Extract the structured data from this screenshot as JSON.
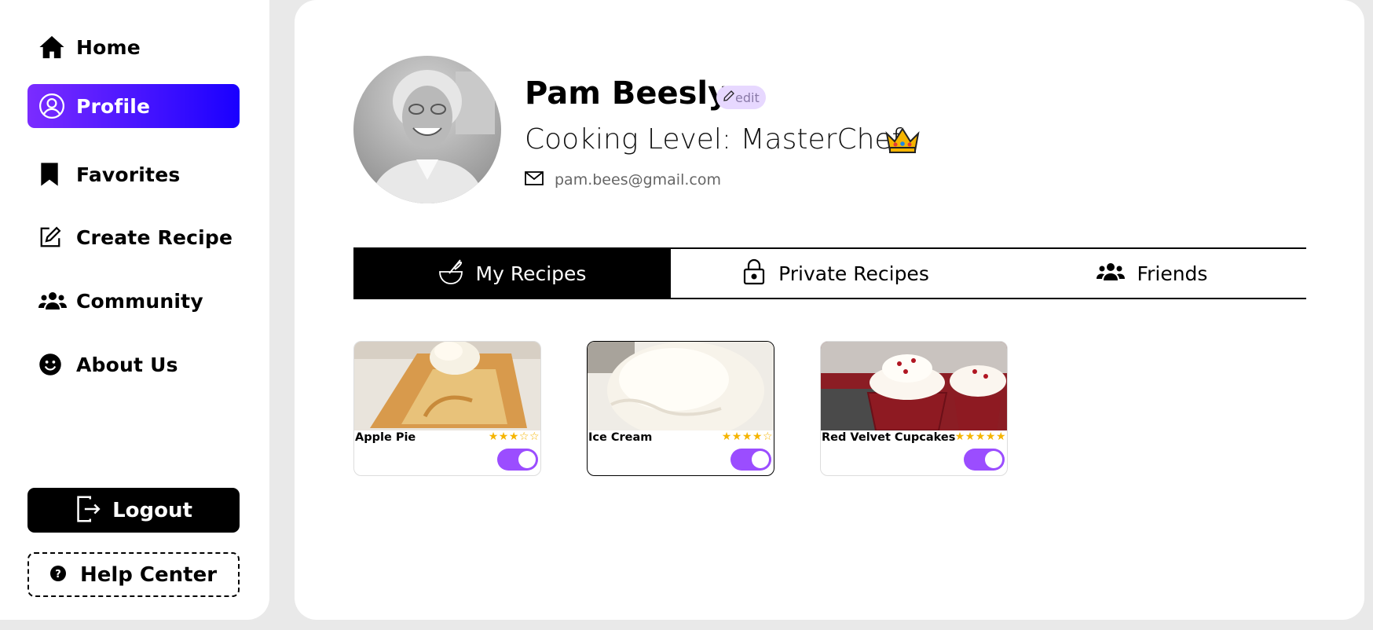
{
  "sidebar": {
    "items": [
      {
        "label": "Home",
        "icon": "home-icon"
      },
      {
        "label": "Profile",
        "icon": "user-circle-icon",
        "active": true
      },
      {
        "label": "Favorites",
        "icon": "bookmark-icon"
      },
      {
        "label": "Create Recipe",
        "icon": "edit-square-icon"
      },
      {
        "label": "Community",
        "icon": "users-icon"
      },
      {
        "label": "About Us",
        "icon": "smiley-icon"
      }
    ],
    "logout_label": "Logout",
    "help_label": "Help Center"
  },
  "profile": {
    "name": "Pam Beesly",
    "edit_label": "edit",
    "cooking_level": "Cooking Level: MasterChef",
    "email": "pam.bees@gmail.com"
  },
  "tabs": [
    {
      "label": "My Recipes",
      "icon": "whisk-bowl-icon",
      "active": true
    },
    {
      "label": "Private Recipes",
      "icon": "lock-icon"
    },
    {
      "label": "Friends",
      "icon": "users-icon"
    }
  ],
  "recipes": [
    {
      "title": "Apple Pie",
      "rating": 3,
      "max_rating": 5,
      "toggle_on": true
    },
    {
      "title": "Ice Cream",
      "rating": 4,
      "max_rating": 5,
      "toggle_on": true
    },
    {
      "title": "Red Velvet Cupcakes",
      "rating": 5,
      "max_rating": 5,
      "toggle_on": true
    }
  ],
  "colors": {
    "accent_start": "#7b2cff",
    "accent_end": "#1a00ff",
    "toggle": "#9b4dff",
    "star": "#f5b400"
  }
}
